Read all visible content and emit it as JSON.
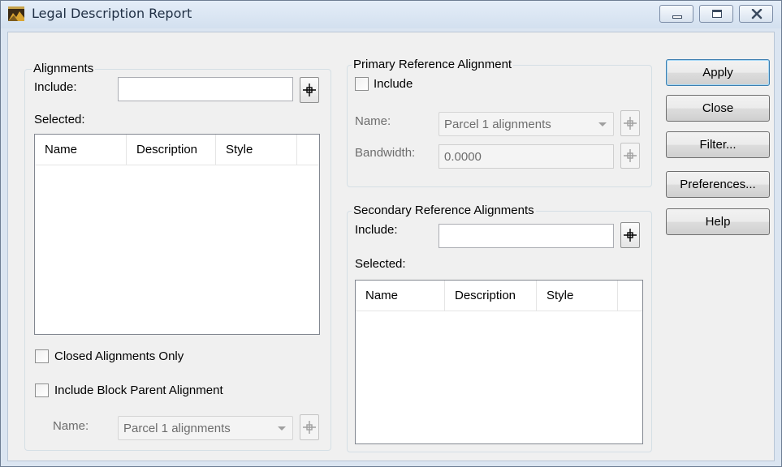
{
  "window": {
    "title": "Legal Description Report",
    "accent": "#dbe5f1"
  },
  "alignments": {
    "group_label": "Alignments",
    "include_label": "Include:",
    "include_value": "",
    "selected_label": "Selected:",
    "columns": [
      "Name",
      "Description",
      "Style"
    ],
    "closed_only_label": "Closed Alignments Only",
    "closed_only_checked": false,
    "block_parent_label": "Include Block Parent Alignment",
    "block_parent_checked": false,
    "name_label": "Name:",
    "name_value": "Parcel 1 alignments"
  },
  "primary": {
    "group_label": "Primary Reference Alignment",
    "include_label": "Include",
    "include_checked": false,
    "name_label": "Name:",
    "name_value": "Parcel 1 alignments",
    "bandwidth_label": "Bandwidth:",
    "bandwidth_value": "0.0000"
  },
  "secondary": {
    "group_label": "Secondary Reference Alignments",
    "include_label": "Include:",
    "include_value": "",
    "selected_label": "Selected:",
    "columns": [
      "Name",
      "Description",
      "Style"
    ]
  },
  "buttons": {
    "apply": "Apply",
    "close": "Close",
    "filter": "Filter...",
    "preferences": "Preferences...",
    "help": "Help"
  }
}
